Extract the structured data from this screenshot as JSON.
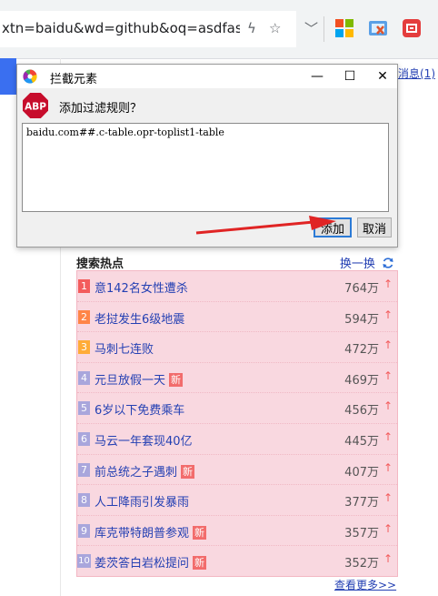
{
  "browser": {
    "url_text": "xtn=baidu&wd=github&oq=asdfasc",
    "chevron": "〉"
  },
  "page": {
    "notice_link": "消息(1)"
  },
  "dialog": {
    "title": "拦截元素",
    "minimize": "—",
    "maximize": "☐",
    "close": "✕",
    "abp_logo_text": "ABP",
    "prompt": "添加过滤规则？",
    "rule_value": "baidu.com##.c-table.opr-toplist1-table",
    "add_label": "添加",
    "cancel_label": "取消"
  },
  "hotlist": {
    "title": "搜索热点",
    "refresh_label": "换一换",
    "new_label": "新",
    "up_arrow": "↑",
    "more_label": "查看更多>>",
    "items": [
      {
        "rank": "1",
        "topic": "意142名女性遭杀",
        "count": "764万",
        "is_new": false
      },
      {
        "rank": "2",
        "topic": "老挝发生6级地震",
        "count": "594万",
        "is_new": false
      },
      {
        "rank": "3",
        "topic": "马刺七连败",
        "count": "472万",
        "is_new": false
      },
      {
        "rank": "4",
        "topic": "元旦放假一天",
        "count": "469万",
        "is_new": true
      },
      {
        "rank": "5",
        "topic": "6岁以下免费乘车",
        "count": "456万",
        "is_new": false
      },
      {
        "rank": "6",
        "topic": "马云一年套现40亿",
        "count": "445万",
        "is_new": false
      },
      {
        "rank": "7",
        "topic": "前总统之子遇刺",
        "count": "407万",
        "is_new": true
      },
      {
        "rank": "8",
        "topic": "人工降雨引发暴雨",
        "count": "377万",
        "is_new": false
      },
      {
        "rank": "9",
        "topic": "库克带特朗普参观",
        "count": "357万",
        "is_new": true
      },
      {
        "rank": "10",
        "topic": "姜茨答白岩松提问",
        "count": "352万",
        "is_new": true
      }
    ]
  },
  "colors": {
    "link_blue": "#2440b3",
    "highlight_pink": "#f9d8e0",
    "rank_top1": "#f35c5c",
    "rank_top2": "#ff8547",
    "rank_top3": "#ffac38",
    "rank_other": "#a9a6dc",
    "arrow_red": "#e02424"
  }
}
